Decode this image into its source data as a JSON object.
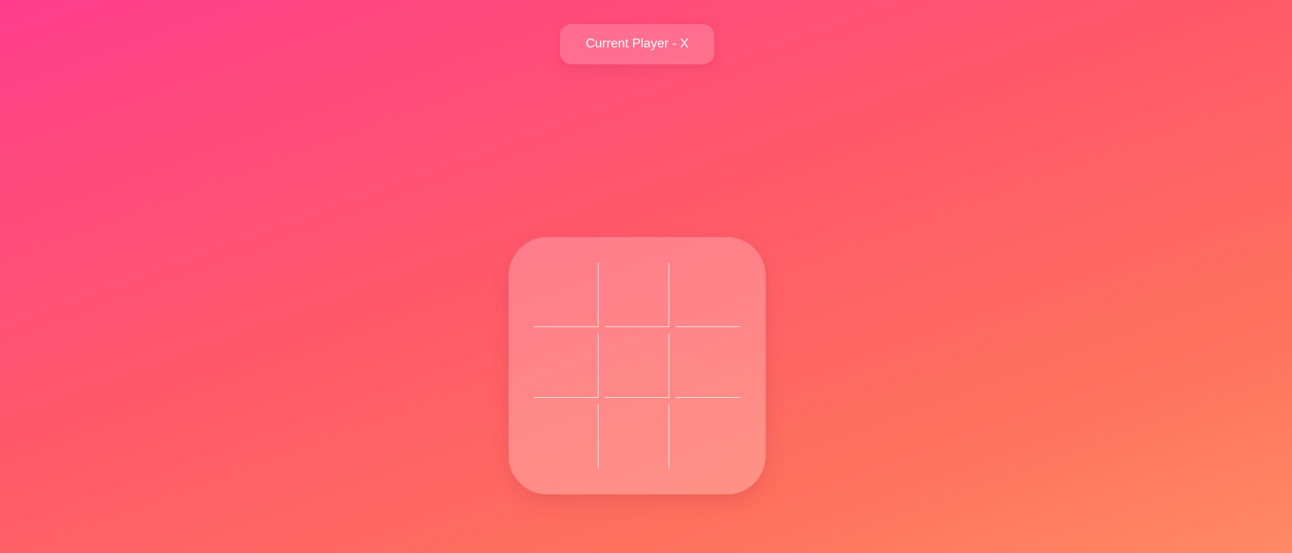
{
  "status": {
    "label": "Current Player - X"
  },
  "board": {
    "cells": [
      "",
      "",
      "",
      "",
      "",
      "",
      "",
      "",
      ""
    ]
  }
}
